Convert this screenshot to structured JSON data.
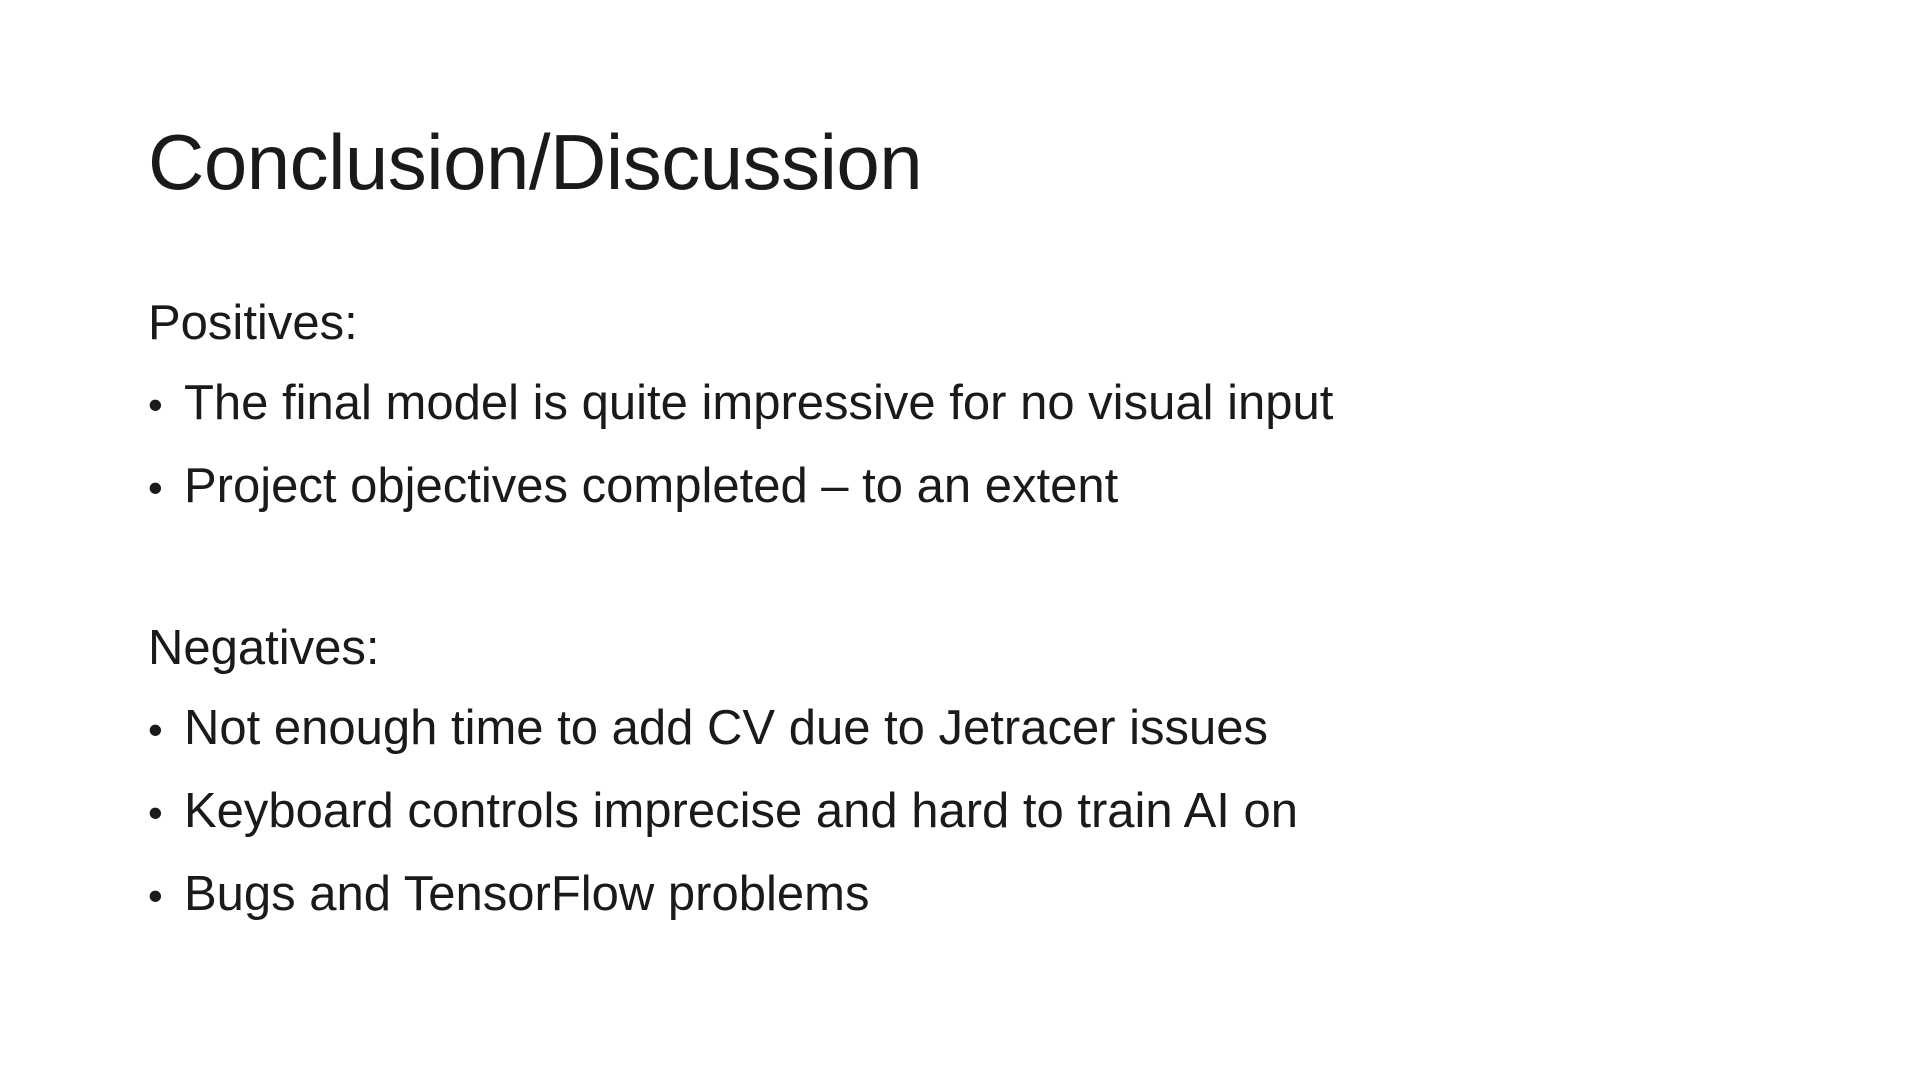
{
  "slide": {
    "title": "Conclusion/Discussion",
    "positives": {
      "heading": "Positives:",
      "items": [
        "The final model is quite impressive for no visual input",
        "Project objectives completed – to an extent"
      ]
    },
    "negatives": {
      "heading": "Negatives:",
      "items": [
        "Not enough time to add CV due to Jetracer issues",
        "Keyboard controls imprecise and hard to train AI on",
        "Bugs and TensorFlow problems"
      ]
    },
    "bullet_glyph": "•"
  }
}
